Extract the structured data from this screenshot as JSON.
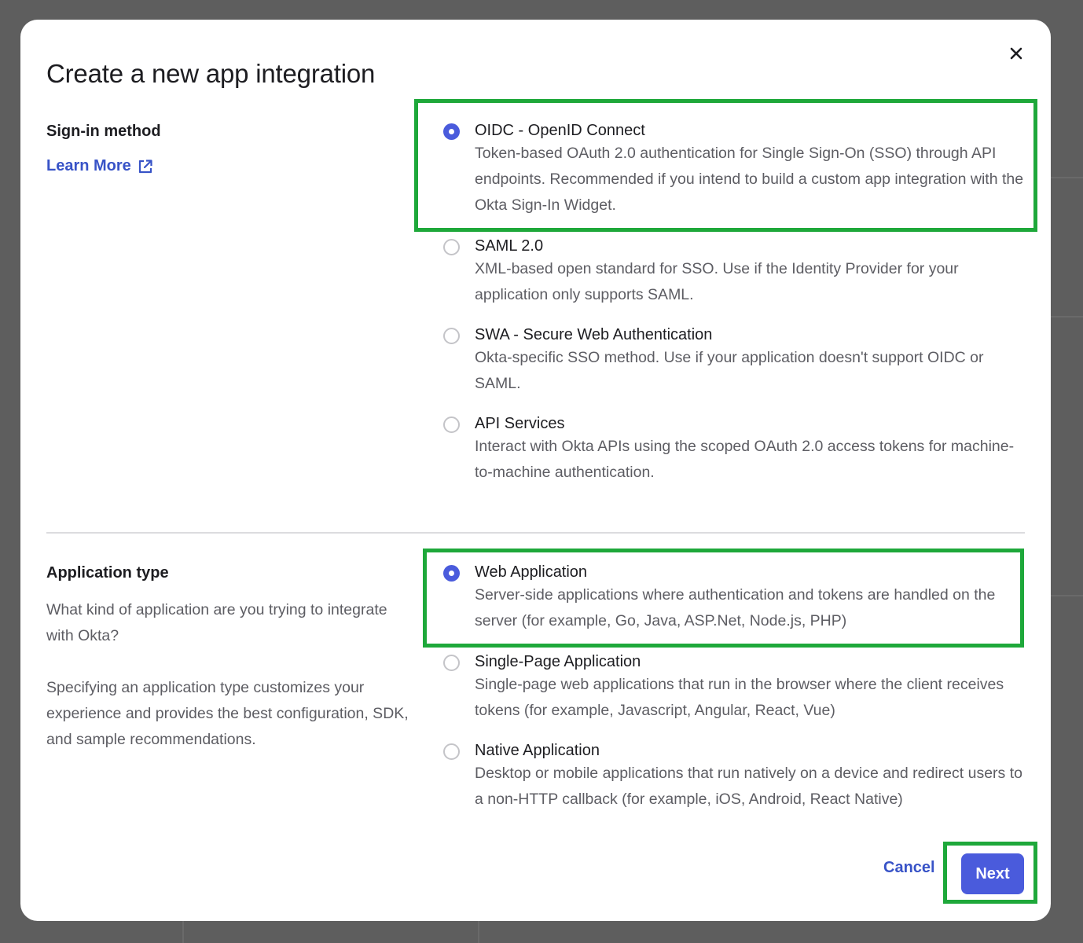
{
  "modal": {
    "title": "Create a new app integration",
    "close_icon": "close-icon"
  },
  "sign_in": {
    "label": "Sign-in method",
    "learn_more": "Learn More",
    "learn_more_icon": "external-link-icon",
    "selected": "OIDC - OpenID Connect",
    "options": [
      {
        "title": "OIDC - OpenID Connect",
        "description": "Token-based OAuth 2.0 authentication for Single Sign-On (SSO) through API endpoints. Recommended if you intend to build a custom app integration with the Okta Sign-In Widget.",
        "checked": true
      },
      {
        "title": "SAML 2.0",
        "description": "XML-based open standard for SSO. Use if the Identity Provider for your application only supports SAML.",
        "checked": false
      },
      {
        "title": "SWA - Secure Web Authentication",
        "description": "Okta-specific SSO method. Use if your application doesn't support OIDC or SAML.",
        "checked": false
      },
      {
        "title": "API Services",
        "description": "Interact with Okta APIs using the scoped OAuth 2.0 access tokens for machine-to-machine authentication.",
        "checked": false
      }
    ]
  },
  "app_type": {
    "label": "Application type",
    "question": "What kind of application are you trying to integrate with Okta?",
    "explanation": "Specifying an application type customizes your experience and provides the best configuration, SDK, and sample recommendations.",
    "selected": "Web Application",
    "options": [
      {
        "title": "Web Application",
        "description": "Server-side applications where authentication and tokens are handled on the server (for example, Go, Java, ASP.Net, Node.js, PHP)",
        "checked": true
      },
      {
        "title": "Single-Page Application",
        "description": "Single-page web applications that run in the browser where the client receives tokens (for example, Javascript, Angular, React, Vue)",
        "checked": false
      },
      {
        "title": "Native Application",
        "description": "Desktop or mobile applications that run natively on a device and redirect users to a non-HTTP callback (for example, iOS, Android, React Native)",
        "checked": false
      }
    ]
  },
  "footer": {
    "cancel_label": "Cancel",
    "next_label": "Next"
  },
  "colors": {
    "primary": "#4a5bdc",
    "link": "#3853c7",
    "highlight": "#1ea83a",
    "overlay": "#5e5e5e"
  }
}
